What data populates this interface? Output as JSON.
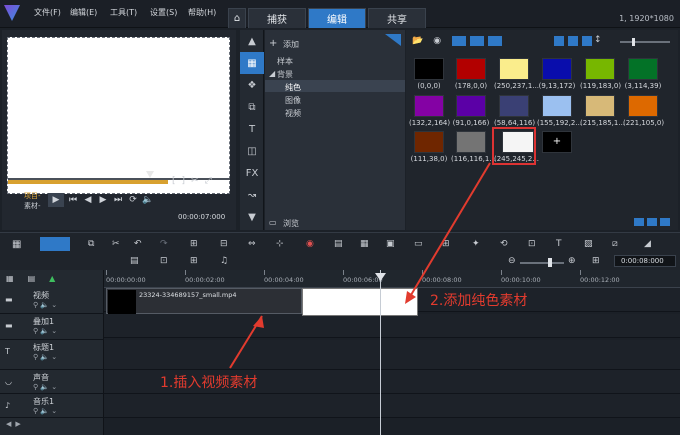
{
  "menu": {
    "file": "文件(F)",
    "edit": "编辑(E)",
    "tools": "工具(T)",
    "settings": "设置(S)",
    "help": "帮助(H)"
  },
  "tabs": [
    {
      "label": "捕获"
    },
    {
      "label": "编辑",
      "active": true
    },
    {
      "label": "共享"
    }
  ],
  "resolution": "1, 1920*1080",
  "preview": {
    "project_label": "项目-",
    "clip_label": "素材-",
    "timecode": "00:00:07:000"
  },
  "library": {
    "add_label": "添加",
    "tree": [
      "样本",
      "背景",
      "纯色",
      "图像",
      "视频"
    ],
    "selected_item": "纯色",
    "browse_label": "浏览"
  },
  "swatches": [
    {
      "label": "(0,0,0)",
      "color": "#000000"
    },
    {
      "label": "(178,0,0)",
      "color": "#b20000"
    },
    {
      "label": "(250,237,1...",
      "color": "#faed8c"
    },
    {
      "label": "(9,13,172)",
      "color": "#090dac"
    },
    {
      "label": "(119,183,0)",
      "color": "#77b700"
    },
    {
      "label": "(3,114,39)",
      "color": "#037227"
    },
    {
      "label": "(132,2,164)",
      "color": "#8402a4"
    },
    {
      "label": "(91,0,166)",
      "color": "#5b00a6"
    },
    {
      "label": "(58,64,116)",
      "color": "#3a4074"
    },
    {
      "label": "(155,192,2...",
      "color": "#9bc0f0"
    },
    {
      "label": "(215,185,1...",
      "color": "#d7b978"
    },
    {
      "label": "(221,105,0)",
      "color": "#dd6900"
    },
    {
      "label": "(111,38,0)",
      "color": "#6f2600"
    },
    {
      "label": "(116,116,1...",
      "color": "#747474"
    },
    {
      "label": "(245,245,2...",
      "color": "#f5f5f5"
    },
    {
      "label": "",
      "color": "#000000"
    }
  ],
  "timeline": {
    "timecode": "0:00:08:000",
    "ruler": [
      "00:00:00:00",
      "00:00:02:00",
      "00:00:04:00",
      "00:00:06:00",
      "00:00:08:00",
      "00:00:10:00",
      "00:00:12:00"
    ],
    "tracks": [
      {
        "name": "视频",
        "icon": "film-icon"
      },
      {
        "name": "叠加1",
        "icon": "overlay-icon"
      },
      {
        "name": "标题1",
        "icon": "title-icon"
      },
      {
        "name": "声音",
        "icon": "mic-icon"
      },
      {
        "name": "音乐1",
        "icon": "music-icon"
      }
    ],
    "video_clip_name": "23324-334689157_small.mp4"
  },
  "annotations": {
    "step1": "1.插入视频素材",
    "step2": "2.添加纯色素材"
  },
  "colors": {
    "accent": "#2f79c7",
    "annotation": "#e23b2e"
  }
}
